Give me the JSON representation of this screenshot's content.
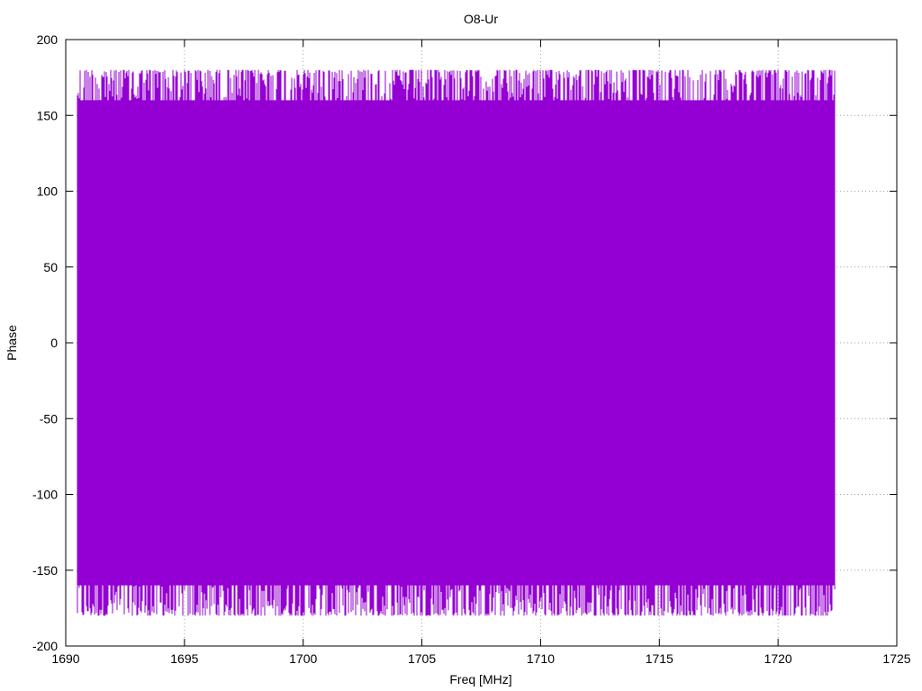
{
  "chart_data": {
    "type": "line",
    "title": "O8-Ur",
    "xlabel": "Freq [MHz]",
    "ylabel": "Phase",
    "xlim": [
      1690,
      1725
    ],
    "ylim": [
      -200,
      200
    ],
    "xticks": [
      1690,
      1695,
      1700,
      1705,
      1710,
      1715,
      1720,
      1725
    ],
    "yticks": [
      -200,
      -150,
      -100,
      -50,
      0,
      50,
      100,
      150,
      200
    ],
    "grid": true,
    "grid_style": "dotted",
    "series": [
      {
        "color": "#9400d3",
        "x_range": [
          1690.5,
          1722.4
        ],
        "y_typical_range": [
          -175,
          175
        ],
        "notable_peaks": [
          {
            "x": 1693.5,
            "y": 85
          },
          {
            "x": 1705.8,
            "y": 45
          },
          {
            "x": 1706.8,
            "y": 65
          },
          {
            "x": 1707.4,
            "y": 50
          },
          {
            "x": 1714.1,
            "y": 55
          },
          {
            "x": 1716.4,
            "y": 74
          }
        ],
        "notable_troughs": [
          {
            "x": 1694.1,
            "y": -78
          },
          {
            "x": 1694.3,
            "y": -85
          },
          {
            "x": 1695.8,
            "y": -54
          },
          {
            "x": 1710.7,
            "y": -82
          },
          {
            "x": 1713.0,
            "y": -78
          },
          {
            "x": 1716.5,
            "y": -87
          },
          {
            "x": 1719.9,
            "y": -72
          }
        ]
      }
    ]
  }
}
